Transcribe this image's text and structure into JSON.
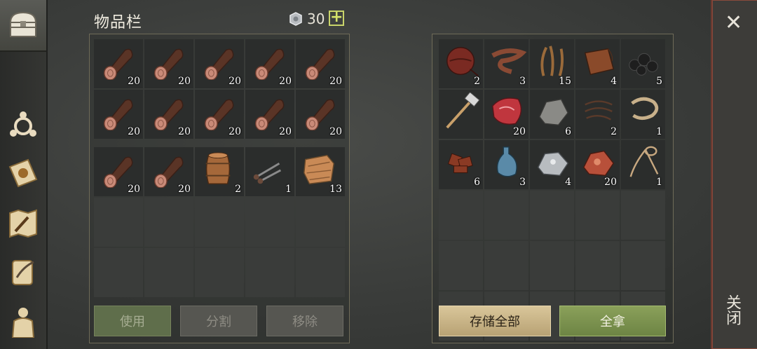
{
  "header": {
    "title": "物品栏",
    "currency_count": "30",
    "plus_label": "+"
  },
  "sidebar": {
    "items": [
      {
        "name": "chest-tab",
        "icon": "chest-icon"
      },
      {
        "name": "crafting-tab",
        "icon": "crafting-icon"
      },
      {
        "name": "sun-map-tab",
        "icon": "sun-book-icon"
      },
      {
        "name": "map-tab",
        "icon": "treasure-map-icon"
      },
      {
        "name": "quests-tab",
        "icon": "scroll-quill-icon"
      },
      {
        "name": "character-tab",
        "icon": "character-icon"
      }
    ]
  },
  "inventory": {
    "slots": [
      {
        "item": "log",
        "qty": "20"
      },
      {
        "item": "log",
        "qty": "20"
      },
      {
        "item": "log",
        "qty": "20"
      },
      {
        "item": "log",
        "qty": "20"
      },
      {
        "item": "log",
        "qty": "20"
      },
      {
        "item": "log",
        "qty": "20"
      },
      {
        "item": "log",
        "qty": "20"
      },
      {
        "item": "log",
        "qty": "20"
      },
      {
        "item": "log",
        "qty": "20"
      },
      {
        "item": "log",
        "qty": "20"
      },
      {
        "item": "log",
        "qty": "20"
      },
      {
        "item": "log",
        "qty": "20"
      },
      {
        "item": "barrel",
        "qty": "2"
      },
      {
        "item": "nails",
        "qty": "1"
      },
      {
        "item": "cloth",
        "qty": "13"
      }
    ]
  },
  "storage": {
    "slots": [
      {
        "item": "leather-bag",
        "qty": "2"
      },
      {
        "item": "leather-strip",
        "qty": "3"
      },
      {
        "item": "plant-fiber",
        "qty": "15"
      },
      {
        "item": "leather-hide",
        "qty": "4"
      },
      {
        "item": "coal",
        "qty": "5"
      },
      {
        "item": "hammer",
        "qty": ""
      },
      {
        "item": "raw-meat",
        "qty": "20"
      },
      {
        "item": "stone",
        "qty": "6"
      },
      {
        "item": "wire",
        "qty": "2"
      },
      {
        "item": "rope",
        "qty": "1"
      },
      {
        "item": "scrap",
        "qty": "6"
      },
      {
        "item": "bottle",
        "qty": "3"
      },
      {
        "item": "iron-ore",
        "qty": "4"
      },
      {
        "item": "copper-ore",
        "qty": "20"
      },
      {
        "item": "lasso",
        "qty": "1"
      }
    ]
  },
  "buttons": {
    "use": "使用",
    "split": "分割",
    "remove": "移除",
    "store_all": "存储全部",
    "take_all": "全拿"
  },
  "close": {
    "x": "✕",
    "label": "关闭"
  },
  "colors": {
    "accent_green": "#6d8444",
    "accent_tan": "#b8a274",
    "close_border": "#8a4a3c"
  }
}
